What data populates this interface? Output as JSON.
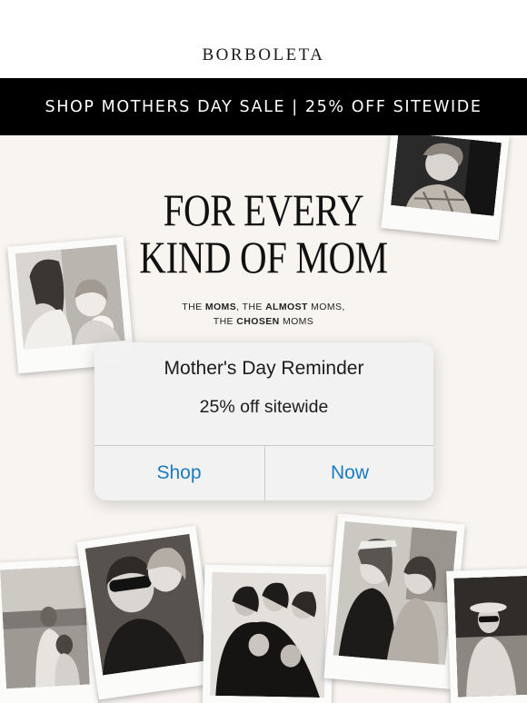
{
  "brand": "BORBOLETA",
  "banner": {
    "text": "SHOP MOTHERS DAY SALE | 25% OFF SITEWIDE"
  },
  "hero": {
    "headline_line1": "FOR EVERY",
    "headline_line2": "KIND OF MOM",
    "tagline": {
      "p1": "THE ",
      "b1": "MOMS",
      "p2": ", THE ",
      "b2": "ALMOST",
      "p3": " MOMS,",
      "p4": "THE ",
      "b3": "CHOSEN",
      "p5": " MOMS"
    }
  },
  "dialog": {
    "title": "Mother's Day Reminder",
    "message": "25% off sitewide",
    "buttons": {
      "left": "Shop",
      "right": "Now"
    }
  },
  "colors": {
    "banner_bg": "#000000",
    "hero_bg": "#f8f5f1",
    "button_text": "#1a7cc0"
  }
}
